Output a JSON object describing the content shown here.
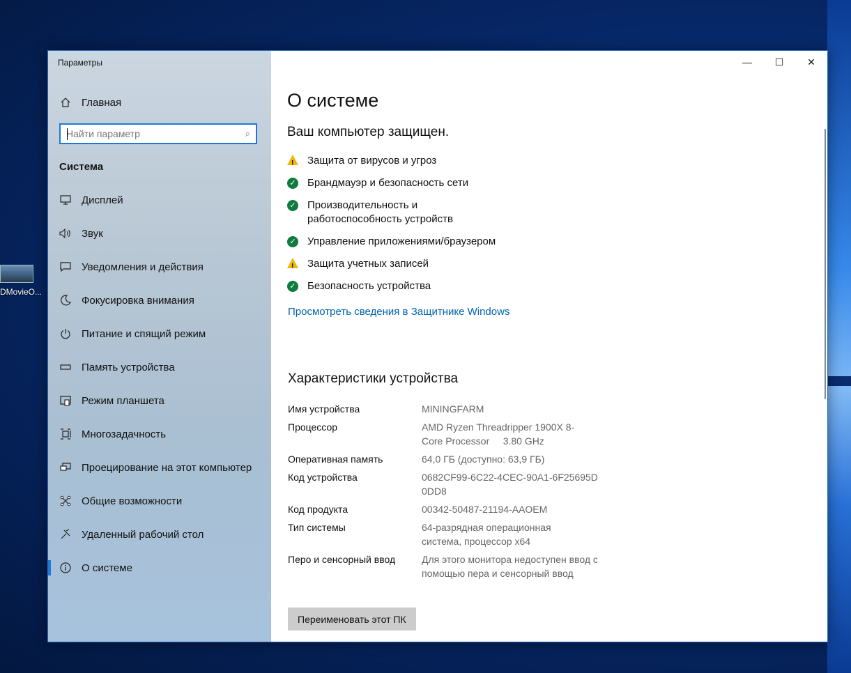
{
  "desktop": {
    "icon_label": "DMovieO..."
  },
  "window": {
    "app_title": "Параметры",
    "controls": {
      "minimize": "—",
      "maximize": "☐",
      "close": "✕"
    }
  },
  "sidebar": {
    "home_label": "Главная",
    "search_placeholder": "Найти параметр",
    "section_title": "Система",
    "items": [
      {
        "label": "Дисплей",
        "icon": "display-icon"
      },
      {
        "label": "Звук",
        "icon": "sound-icon"
      },
      {
        "label": "Уведомления и действия",
        "icon": "notifications-icon"
      },
      {
        "label": "Фокусировка внимания",
        "icon": "focus-moon-icon"
      },
      {
        "label": "Питание и спящий режим",
        "icon": "power-icon"
      },
      {
        "label": "Память устройства",
        "icon": "storage-icon"
      },
      {
        "label": "Режим планшета",
        "icon": "tablet-icon"
      },
      {
        "label": "Многозадачность",
        "icon": "multitasking-icon"
      },
      {
        "label": "Проецирование на этот компьютер",
        "icon": "projecting-icon"
      },
      {
        "label": "Общие возможности",
        "icon": "shared-experiences-icon"
      },
      {
        "label": "Удаленный рабочий стол",
        "icon": "remote-desktop-icon"
      },
      {
        "label": "О системе",
        "icon": "info-icon",
        "active": true
      }
    ]
  },
  "main": {
    "title": "О системе",
    "protection_heading": "Ваш компьютер защищен.",
    "security_items": [
      {
        "label": "Защита от вирусов и угроз",
        "status": "warning"
      },
      {
        "label": "Брандмауэр и безопасность сети",
        "status": "ok"
      },
      {
        "label": "Производительность и работоспособность устройств",
        "status": "ok"
      },
      {
        "label": "Управление приложениями/браузером",
        "status": "ok"
      },
      {
        "label": "Защита учетных записей",
        "status": "warning"
      },
      {
        "label": "Безопасность устройства",
        "status": "ok"
      }
    ],
    "defender_link": "Просмотреть сведения в Защитнике Windows",
    "specs_heading": "Характеристики устройства",
    "specs": [
      {
        "key": "Имя устройства",
        "value": "MININGFARM"
      },
      {
        "key": "Процессор",
        "value": "AMD Ryzen Threadripper 1900X 8-Core Processor     3.80 GHz"
      },
      {
        "key": "Оперативная память",
        "value": "64,0 ГБ (доступно: 63,9 ГБ)"
      },
      {
        "key": "Код устройства",
        "value": "0682CF99-6C22-4CEC-90A1-6F25695D0DD8"
      },
      {
        "key": "Код продукта",
        "value": "00342-50487-21194-AAOEM"
      },
      {
        "key": "Тип системы",
        "value": "64-разрядная операционная система, процессор x64"
      },
      {
        "key": "Перо и сенсорный ввод",
        "value": "Для этого монитора недоступен ввод с помощью пера и сенсорный ввод"
      }
    ],
    "rename_button": "Переименовать этот ПК"
  }
}
